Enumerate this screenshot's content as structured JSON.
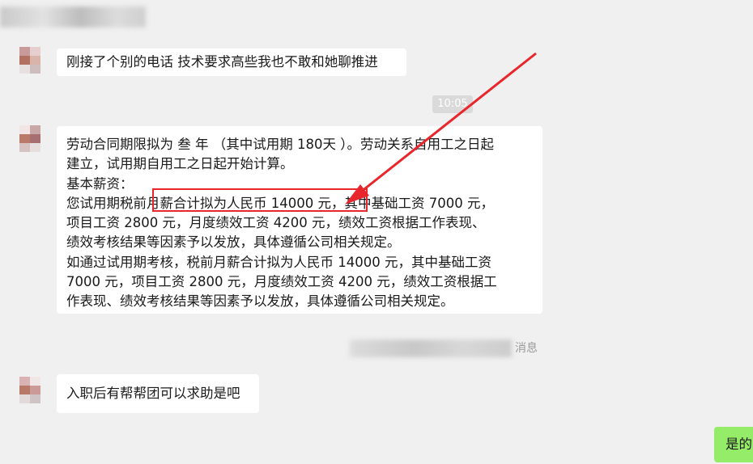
{
  "header": {
    "title_blurred": true
  },
  "messages": [
    {
      "id": "m1",
      "text": "刚接了个别的电话 技术要求高些我也不敢和她聊推进"
    },
    {
      "id": "m2",
      "lines": [
        "劳动合同期限拟为 叁 年 （其中试用期 180天 ）。劳动关系自用工之日起",
        "建立，试用期自用工之日起开始计算。",
        "基本薪资：",
        "您试用期税前月薪合计拟为人民币  14000   元，其中基础工资 7000  元，",
        "项目工资    2800  元，月度绩效工资    4200 元，绩效工资根据工作表现、",
        "绩效考核结果等因素予以发放，具体遵循公司相关规定。",
        "如通过试用期考核，税前月薪合计拟为人民币  14000 元，其中基础工资",
        "7000 元，项目工资    2800    元，月度绩效工资  4200 元，绩效工资根据工",
        "作表现、绩效考核结果等因素予以发放，具体遵循公司相关规定。"
      ]
    },
    {
      "id": "m3",
      "text": "入职后有帮帮团可以求助是吧"
    },
    {
      "id": "m4",
      "text": "是的"
    }
  ],
  "timestamp": "10:05",
  "system_notice": "消息",
  "colors": {
    "highlight": "#e8262b",
    "self_bubble": "#95ec69",
    "background": "#f0f0f0"
  }
}
